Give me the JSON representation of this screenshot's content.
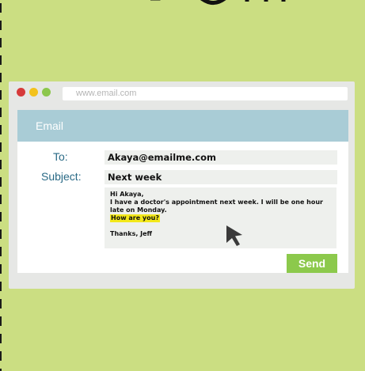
{
  "browser": {
    "url": "www.email.com"
  },
  "email": {
    "header_title": "Email",
    "to_label": "To:",
    "to_value": "Akaya@emailme.com",
    "subject_label": "Subject:",
    "subject_value": "Next week",
    "body_greeting": "Hi Akaya,",
    "body_line": "I have a doctor's appointment next week. I will be one hour late on Monday.",
    "body_highlight": "How are you?",
    "body_signoff": "Thanks, Jeff",
    "send_label": "Send"
  },
  "colors": {
    "background": "#cbde82",
    "header": "#a9ccd6",
    "label": "#2a6a86",
    "send_button": "#8cc94c",
    "highlight": "#f3e81a"
  },
  "icons": [
    "red-dot-icon",
    "yellow-dot-icon",
    "green-dot-icon",
    "mouse-pointer-icon"
  ]
}
